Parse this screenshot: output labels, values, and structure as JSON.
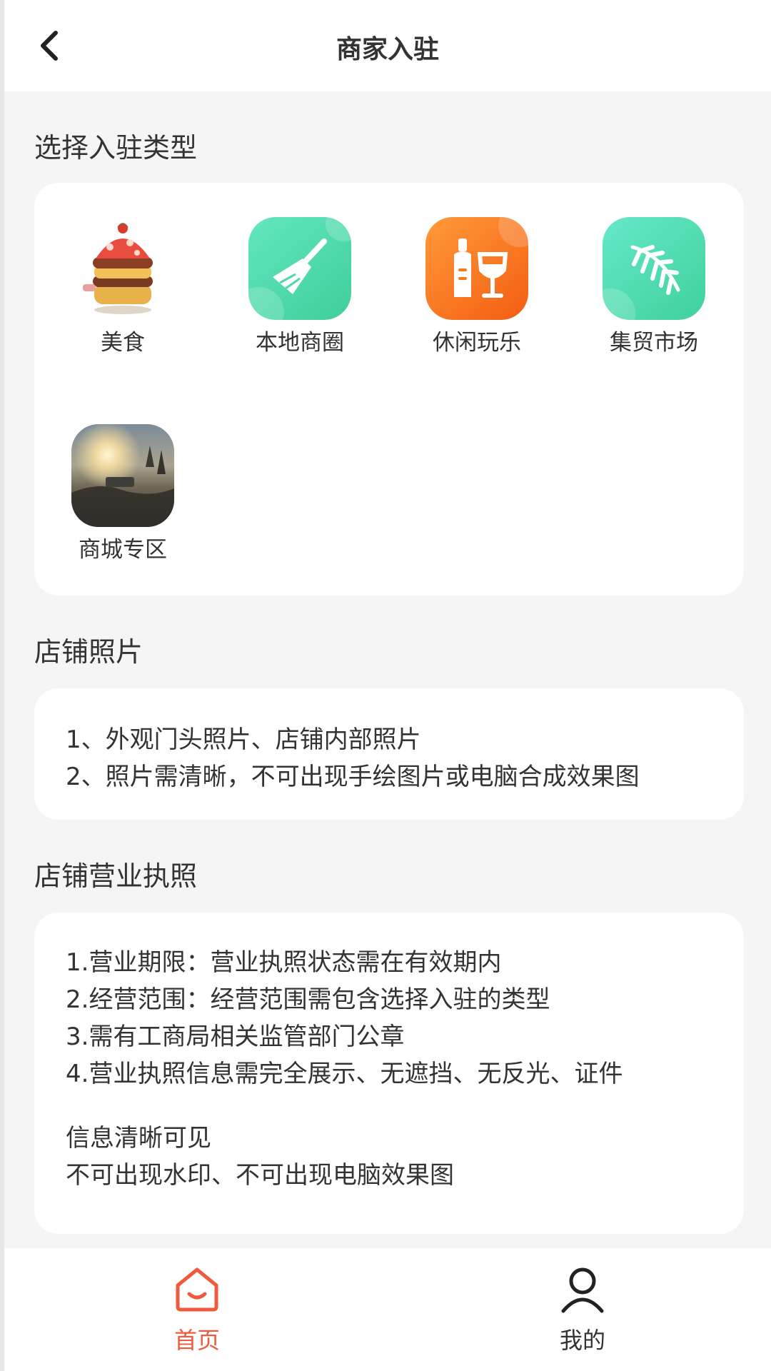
{
  "header": {
    "title": "商家入驻"
  },
  "type_section": {
    "title": "选择入驻类型",
    "categories": [
      {
        "label": "美食",
        "icon": "burger-icon"
      },
      {
        "label": "本地商圈",
        "icon": "broom-icon"
      },
      {
        "label": "休闲玩乐",
        "icon": "drinks-icon"
      },
      {
        "label": "集贸市场",
        "icon": "leaf-icon"
      },
      {
        "label": "商城专区",
        "icon": "landscape-photo-icon"
      }
    ]
  },
  "photo_section": {
    "title": "店铺照片",
    "lines": [
      "1、外观门头照片、店铺内部照片",
      "2、照片需清晰，不可出现手绘图片或电脑合成效果图"
    ]
  },
  "license_section": {
    "title": "店铺营业执照",
    "lines": [
      "1.营业期限：营业执照状态需在有效期内",
      "2.经营范围：经营范围需包含选择入驻的类型",
      "3.需有工商局相关监管部门公章",
      "4.营业执照信息需完全展示、无遮挡、无反光、证件"
    ],
    "extra_lines": [
      "信息清晰可见",
      "不可出现水印、不可出现电脑效果图"
    ]
  },
  "tabbar": {
    "tabs": [
      {
        "label": "首页",
        "icon": "home-icon",
        "active": true
      },
      {
        "label": "我的",
        "icon": "user-icon",
        "active": false
      }
    ]
  },
  "colors": {
    "accent": "#f05a3c",
    "background": "#f5f5f5",
    "card": "#ffffff"
  }
}
